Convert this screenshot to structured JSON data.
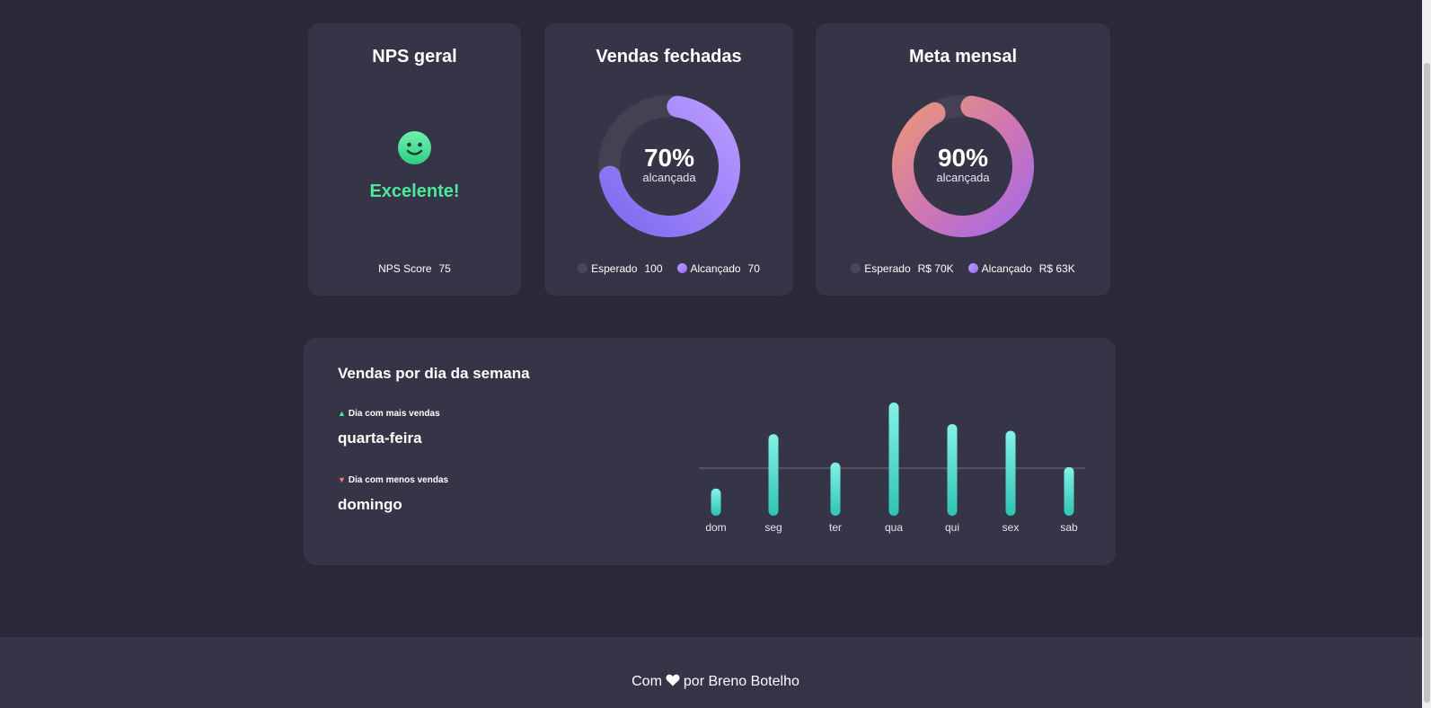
{
  "nps": {
    "title": "NPS geral",
    "status": "Excelente!",
    "score_label": "NPS Score",
    "score_value": "75",
    "icon": "smiley-icon"
  },
  "vendas": {
    "title": "Vendas fechadas",
    "percent_text": "70%",
    "sub": "alcançada",
    "percent": 70,
    "expected_label": "Esperado",
    "expected_value": "100",
    "achieved_label": "Alcançado",
    "achieved_value": "70"
  },
  "meta": {
    "title": "Meta mensal",
    "percent_text": "90%",
    "sub": "alcançada",
    "percent": 90,
    "expected_label": "Esperado",
    "expected_value": "R$ 70K",
    "achieved_label": "Alcançado",
    "achieved_value": "R$ 63K"
  },
  "week": {
    "title": "Vendas por dia da semana",
    "best_label": "Dia com mais vendas",
    "best_value": "quarta-feira",
    "worst_label": "Dia com menos vendas",
    "worst_value": "domingo"
  },
  "chart_data": {
    "type": "bar",
    "categories": [
      "dom",
      "seg",
      "ter",
      "qua",
      "qui",
      "sex",
      "sab"
    ],
    "values": [
      24,
      72,
      47,
      100,
      81,
      75,
      43
    ],
    "reference_line": 42,
    "ylim": [
      0,
      100
    ]
  },
  "footer": {
    "prefix": "Com",
    "suffix": "por Breno Botelho",
    "icon": "heart-icon"
  },
  "colors": {
    "background": "#2a2839",
    "card": "#363447",
    "nps_green": "#4de89b",
    "bar_top": "#84f2e6",
    "bar_bottom": "#2ec4b6",
    "purple_start": "#b99aff",
    "purple_end": "#7d6af0",
    "meta_start": "#e8967a",
    "meta_end": "#a86ae6"
  }
}
